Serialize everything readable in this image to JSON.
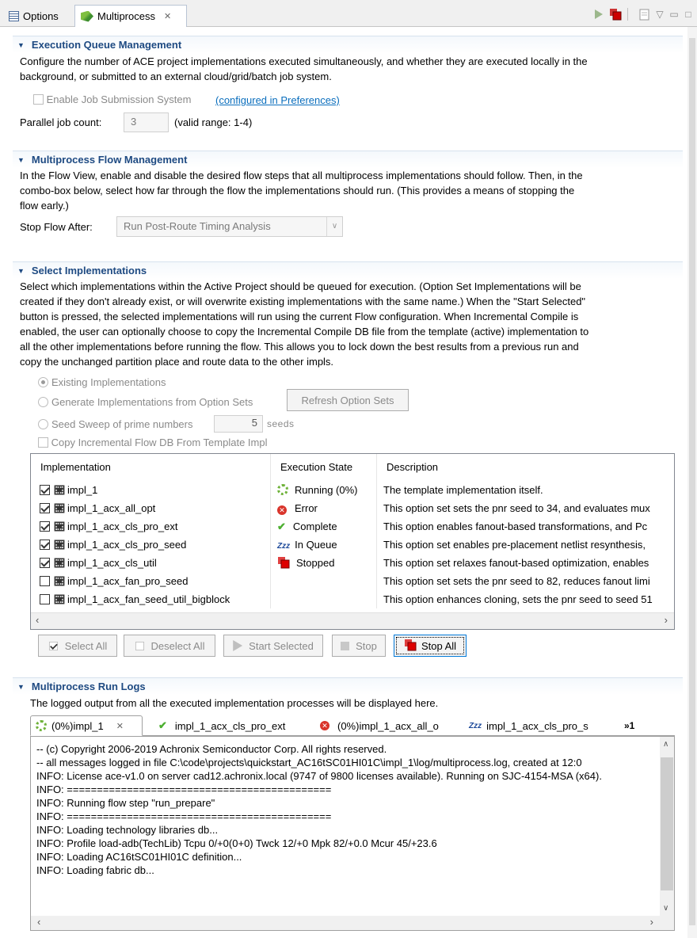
{
  "tabs": [
    {
      "label": "Options"
    },
    {
      "label": "Multiprocess",
      "close": "✕"
    }
  ],
  "queue": {
    "title": "Execution Queue Management",
    "desc1": "Configure the number of ACE project implementations executed simultaneously, and whether they are executed locally in the",
    "desc2": "background, or submitted to an external cloud/grid/batch job system.",
    "enable_label": "Enable Job Submission System",
    "pref_link": "(configured in Preferences)",
    "parallel_label": "Parallel job count:",
    "parallel_value": "3",
    "range_label": "(valid range: 1-4)"
  },
  "flow": {
    "title": "Multiprocess Flow Management",
    "desc1": "In the Flow View, enable and disable the desired flow steps that all multiprocess implementations should follow.  Then, in the",
    "desc2": "combo-box below, select how far through the flow the implementations should run.  (This provides a means of stopping the",
    "desc3": "flow early.)",
    "stop_label": "Stop Flow After:",
    "stop_value": "Run Post-Route Timing Analysis"
  },
  "select": {
    "title": "Select Implementations",
    "lines": [
      "Select which implementations within the Active Project should be queued for execution.  (Option Set Implementations will be",
      "created if they don't already exist, or will overwrite existing implementations with the same name.)  When the \"Start Selected\"",
      "button is pressed, the selected implementations will run using the current Flow configuration.  When Incremental Compile is",
      "enabled, the user can optionally choose to copy the Incremental Compile DB file from the template (active) implementation to",
      "all the other implementations before running the flow.  This allows you to lock down the best results from a previous run and",
      "copy the unchanged partition place and route data to the other impls."
    ],
    "opt_existing": "Existing Implementations",
    "opt_generate": "Generate Implementations from Option Sets",
    "refresh_btn": "Refresh Option Sets",
    "opt_seed": "Seed Sweep of prime numbers",
    "seed_value": "5",
    "seeds_label": "seeds",
    "copy_label": "Copy Incremental Flow DB From Template Impl"
  },
  "table": {
    "headers": [
      "Implementation",
      "Execution State",
      "Description"
    ],
    "rows": [
      {
        "checked": true,
        "name": "impl_1",
        "state": "Running (0%)",
        "state_icon": "running-icon",
        "desc": "The template implementation itself."
      },
      {
        "checked": true,
        "name": "impl_1_acx_all_opt",
        "state": "Error",
        "state_icon": "error-icon",
        "desc": "This option set sets the pnr seed to 34, and evaluates mux"
      },
      {
        "checked": true,
        "name": "impl_1_acx_cls_pro_ext",
        "state": "Complete",
        "state_icon": "check-icon",
        "desc": "This option enables fanout-based transformations, and Pc"
      },
      {
        "checked": true,
        "name": "impl_1_acx_cls_pro_seed",
        "state": "In Queue",
        "state_icon": "queue-icon",
        "desc": "This option set enables pre-placement netlist resynthesis,"
      },
      {
        "checked": true,
        "name": "impl_1_acx_cls_util",
        "state": "Stopped",
        "state_icon": "stopped-icon",
        "desc": "This option set relaxes fanout-based optimization, enables"
      },
      {
        "checked": false,
        "name": "impl_1_acx_fan_pro_seed",
        "state": "",
        "state_icon": "",
        "desc": "This option set sets the pnr seed to 82, reduces fanout limi"
      },
      {
        "checked": false,
        "name": "impl_1_acx_fan_seed_util_bigblock",
        "state": "",
        "state_icon": "",
        "desc": "This option enhances cloning, sets the pnr seed to seed 51"
      }
    ]
  },
  "buttons": {
    "select_all": "Select All",
    "deselect_all": "Deselect All",
    "start_selected": "Start Selected",
    "stop": "Stop",
    "stop_all": "Stop All"
  },
  "logs": {
    "title": "Multiprocess Run Logs",
    "desc": "The logged output from all the executed implementation processes will be displayed here.",
    "tabs": [
      "(0%)impl_1",
      "impl_1_acx_cls_pro_ext",
      "(0%)impl_1_acx_all_o",
      "impl_1_acx_cls_pro_s"
    ],
    "overflow": "»1",
    "lines": [
      "-- (c) Copyright 2006-2019 Achronix Semiconductor Corp.  All rights reserved.",
      "-- all messages logged in file C:\\code\\projects\\quickstart_AC16tSC01HI01C\\impl_1\\log/multiprocess.log, created at 12:0",
      "INFO: License ace-v1.0 on server cad12.achronix.local (9747 of 9800 licenses available). Running on SJC-4154-MSA (x64).",
      "INFO: ============================================",
      "INFO: Running flow step \"run_prepare\"",
      "INFO: ============================================",
      "INFO: Loading technology libraries db...",
      "INFO: Profile load-adb(TechLib) Tcpu 0/+0(0+0) Twck 12/+0 Mpk 82/+0.0 Mcur 45/+23.6",
      "INFO: Loading AC16tSC01HI01C definition...",
      "INFO: Loading fabric db..."
    ]
  }
}
